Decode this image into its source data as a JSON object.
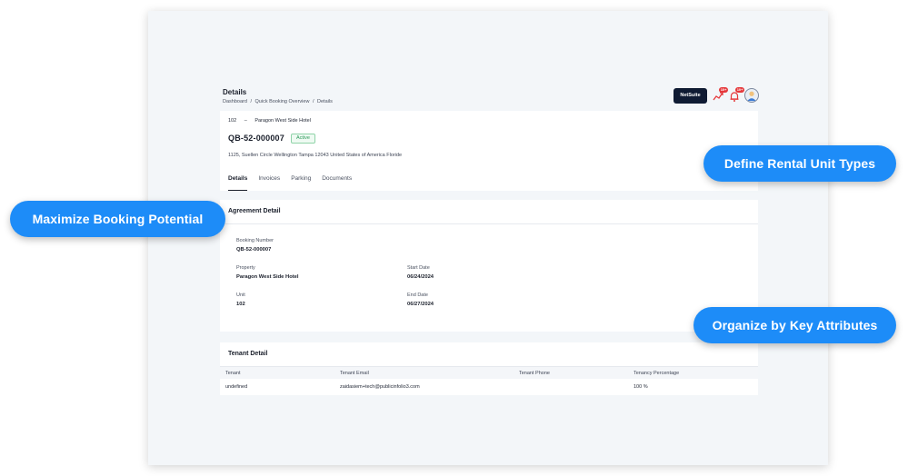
{
  "header": {
    "title": "Details",
    "breadcrumb": [
      "Dashboard",
      "Quick Booking Overview",
      "Details"
    ],
    "breadcrumb_separator": "/",
    "netsuite_label": "NetSuite",
    "notification_badge_1": "10+",
    "notification_badge_2": "10+"
  },
  "summary": {
    "unit": "102",
    "unit_separator": "–",
    "property": "Paragon West Side Hotel",
    "booking_id": "QB-52-000007",
    "status": "Active",
    "address": "1125, Suellen Circle Wellington Tampa 12043 United States of America Floride",
    "tabs": [
      "Details",
      "Invoices",
      "Parking",
      "Documents"
    ],
    "active_tab": "Details"
  },
  "agreement": {
    "title": "Agreement Detail",
    "booking_number_label": "Booking Number",
    "booking_number_value": "QB-52-000007",
    "property_label": "Property",
    "property_value": "Paragon West Side Hotel",
    "start_date_label": "Start Date",
    "start_date_value": "06/24/2024",
    "unit_label": "Unit",
    "unit_value": "102",
    "end_date_label": "End Date",
    "end_date_value": "06/27/2024"
  },
  "tenant": {
    "title": "Tenant Detail",
    "columns": [
      "Tenant",
      "Tenant Email",
      "Tenant Phone",
      "Tenancy Percentage"
    ],
    "rows": [
      [
        "undefined",
        "zaidasiem+tech@publicinfolio3.com",
        "",
        "100 %"
      ]
    ]
  },
  "callouts": {
    "define_rental": "Define Rental Unit Types",
    "maximize_booking": "Maximize Booking Potential",
    "organize_attributes": "Organize by Key Attributes"
  },
  "colors": {
    "accent": "#1d8cf8",
    "netsuite_bg": "#0f1b33",
    "status_green": "#2e9a5a",
    "badge_red": "#e5383b"
  },
  "icons": [
    "trend-icon",
    "bell-icon",
    "avatar-icon"
  ]
}
